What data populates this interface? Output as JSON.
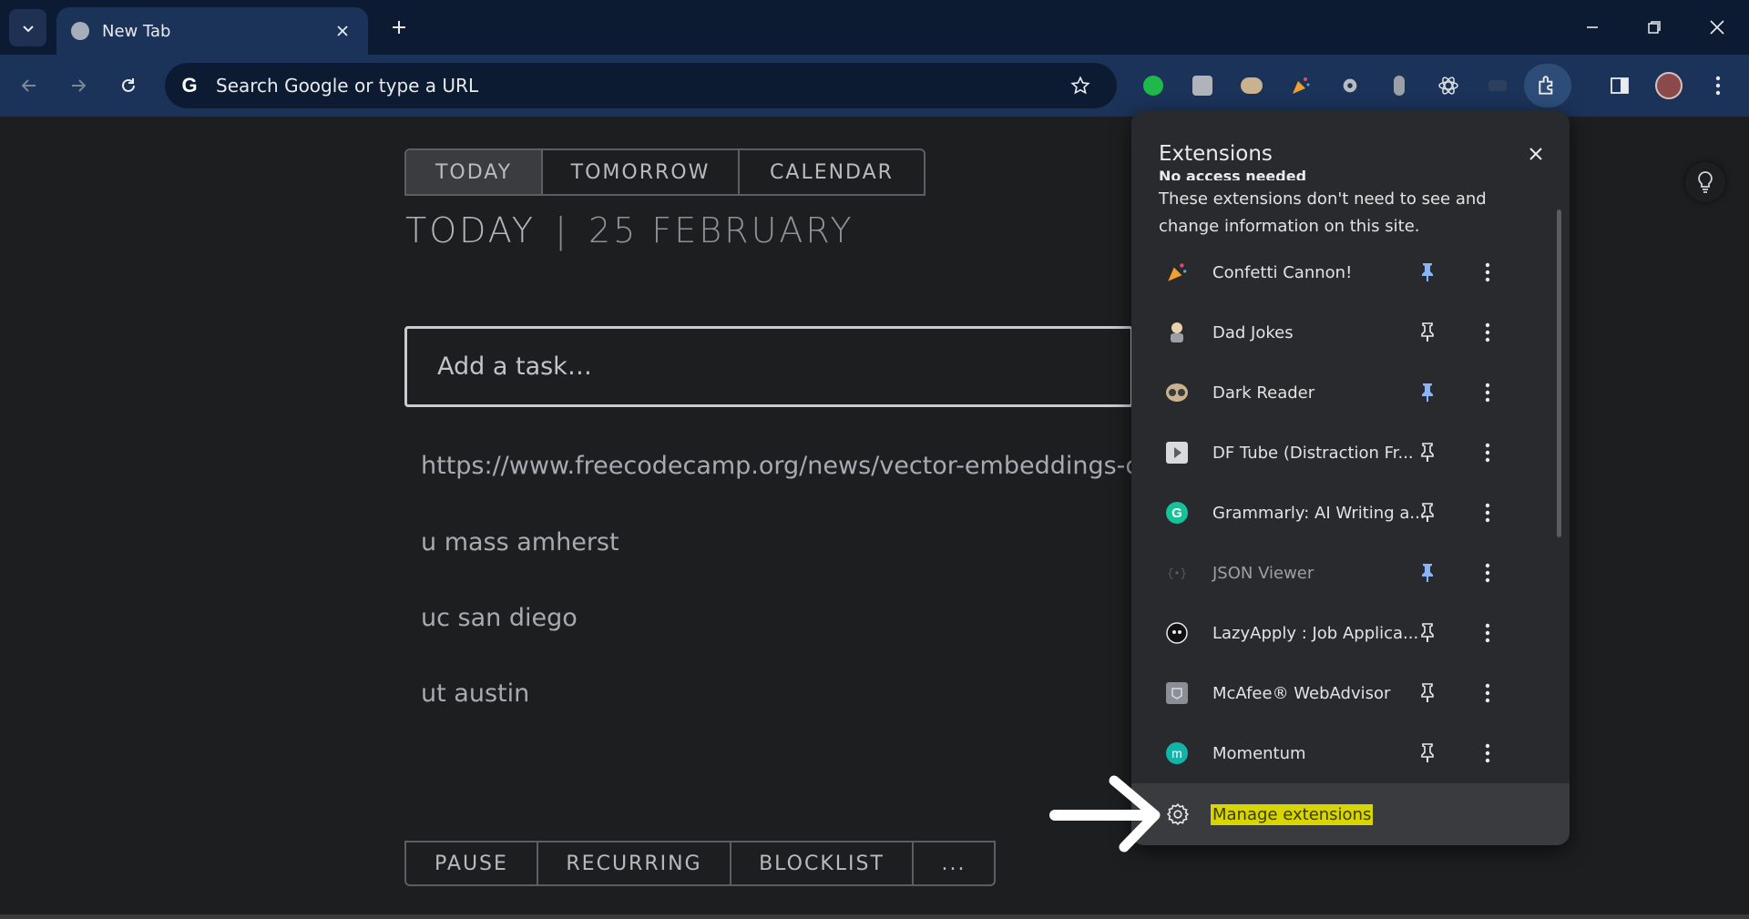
{
  "browser": {
    "tab_title": "New Tab",
    "omnibox_placeholder": "Search Google or type a URL"
  },
  "page": {
    "tabs": [
      "TODAY",
      "TOMORROW",
      "CALENDAR"
    ],
    "heading_left": "TODAY",
    "heading_sep": "|",
    "heading_date": "25 FEBRUARY",
    "task_placeholder": "Add a task…",
    "tasks": [
      "https://www.freecodecamp.org/news/vector-embeddings-cour",
      "u mass amherst",
      "uc san diego",
      "ut austin"
    ],
    "bottom_tabs": [
      "PAUSE",
      "RECURRING",
      "BLOCKLIST",
      "..."
    ]
  },
  "extensions_panel": {
    "title": "Extensions",
    "section": "No access needed",
    "description": "These extensions don't need to see and change information on this site.",
    "items": [
      {
        "name": "Confetti Cannon!",
        "icon": "confetti-icon",
        "pinned": true
      },
      {
        "name": "Dad Jokes",
        "icon": "dad-jokes-icon",
        "pinned": false
      },
      {
        "name": "Dark Reader",
        "icon": "dark-reader-icon",
        "pinned": true
      },
      {
        "name": "DF Tube (Distraction Fr...",
        "icon": "df-tube-icon",
        "pinned": false
      },
      {
        "name": "Grammarly: AI Writing a...",
        "icon": "grammarly-icon",
        "pinned": false
      },
      {
        "name": "JSON Viewer",
        "icon": "json-viewer-icon",
        "pinned": true
      },
      {
        "name": "LazyApply : Job Applica...",
        "icon": "lazyapply-icon",
        "pinned": false
      },
      {
        "name": "McAfee® WebAdvisor",
        "icon": "mcafee-icon",
        "pinned": false
      },
      {
        "name": "Momentum",
        "icon": "momentum-icon",
        "pinned": false
      }
    ],
    "manage_label": "Manage extensions"
  },
  "colors": {
    "accent_pin": "#8ab4f8",
    "tabbar_bg": "#0c1b32",
    "toolbar_bg": "#1b3358",
    "highlight": "#d8d600"
  }
}
